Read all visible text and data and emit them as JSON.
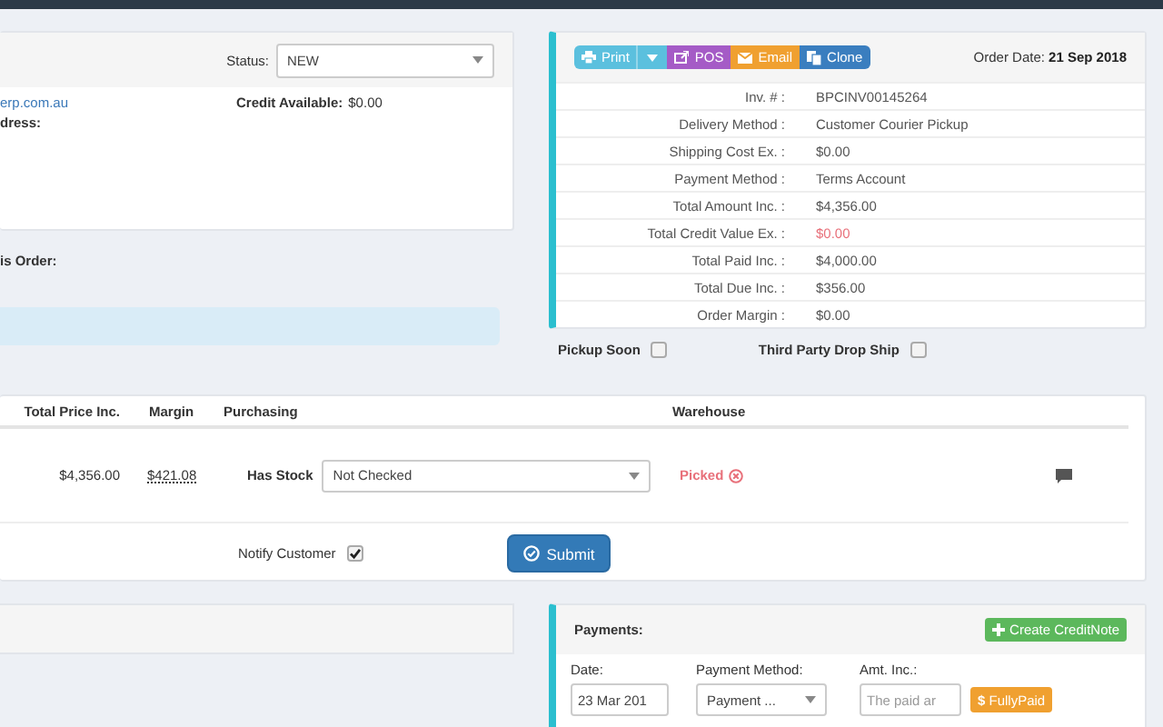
{
  "customer_panel": {
    "status_label": "Status:",
    "status_value": "NEW",
    "email": "erp.com.au",
    "address_label": "dress:",
    "credit_label": "Credit Available:",
    "credit_value": "$0.00"
  },
  "order_note_label": "is Order:",
  "invoice_panel": {
    "buttons": [
      {
        "label": "Print",
        "kind": "print"
      },
      {
        "label": "POS",
        "kind": "pos"
      },
      {
        "label": "Email",
        "kind": "email"
      },
      {
        "label": "Clone",
        "kind": "clone"
      }
    ],
    "order_date_label": "Order Date:",
    "order_date": "21 Sep 2018",
    "rows": [
      {
        "label": "Inv. # :",
        "value": "BPCINV00145264",
        "alert": false
      },
      {
        "label": "Delivery Method :",
        "value": "Customer Courier Pickup",
        "alert": false
      },
      {
        "label": "Shipping Cost Ex. :",
        "value": "$0.00",
        "alert": false
      },
      {
        "label": "Payment Method :",
        "value": "Terms Account",
        "alert": false
      },
      {
        "label": "Total Amount Inc. :",
        "value": "$4,356.00",
        "alert": false
      },
      {
        "label": "Total Credit Value Ex. :",
        "value": "$0.00",
        "alert": true
      },
      {
        "label": "Total Paid Inc. :",
        "value": "$4,000.00",
        "alert": false
      },
      {
        "label": "Total Due Inc. :",
        "value": "$356.00",
        "alert": false
      },
      {
        "label": "Order Margin :",
        "value": "$0.00",
        "alert": false
      }
    ]
  },
  "options": [
    {
      "label": "Pickup Soon",
      "checked": false
    },
    {
      "label": "Third Party Drop Ship",
      "checked": false
    }
  ],
  "items_table": {
    "columns": [
      "Total Price Inc.",
      "Margin",
      "Purchasing",
      "Warehouse"
    ],
    "row": {
      "total_price": "$4,356.00",
      "margin": "$421.08",
      "purchasing_label": "Has Stock",
      "purchasing_value": "Not Checked",
      "warehouse": "Picked"
    },
    "notify": {
      "label": "Notify Customer",
      "checked": true
    },
    "submit": "Submit"
  },
  "payments": {
    "title": "Payments:",
    "create_button": "Create CreditNote",
    "date_label": "Date:",
    "method_label": "Payment Method:",
    "amount_label": "Amt. Inc.:",
    "date_value": "23 Mar 201",
    "method_value": "Payment ...",
    "amount_placeholder": "The paid ar",
    "fully_paid_symbol": "$",
    "fully_paid": "FullyPaid"
  }
}
